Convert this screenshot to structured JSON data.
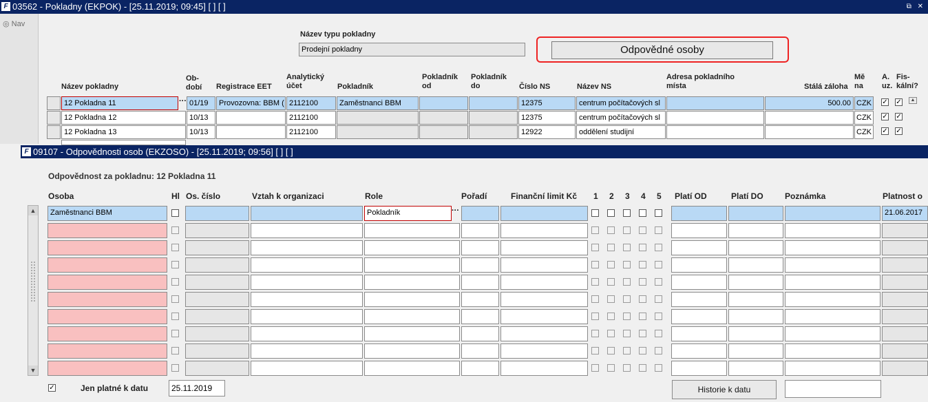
{
  "main_window": {
    "title": "03562 - Pokladny (EKPOK) - [25.11.2019; 09:45]  [ ]  [ ]",
    "window_controls": "⧉ ✕",
    "nav_label": "Nav",
    "typ_label": "Název typu pokladny",
    "typ_value": "Prodejní pokladny",
    "button_label": "Odpovědné osoby",
    "columns": {
      "nazev": "Název pokladny",
      "obdobi": "Ob-\nbodí",
      "registrace": "Registrace EET",
      "ucet": "Analytický\núčet",
      "pokladnik": "Pokladník",
      "pok_od": "Pokladník\nod",
      "pok_do": "Pokladník\ndo",
      "cislo_ns": "Číslo NS",
      "nazev_ns": "Název NS",
      "adresa": "Adresa pokladního\nmísta",
      "zaloha": "Stálá záloha",
      "mena": "Mě\nna",
      "auz": "A.\nuz.",
      "fiskalni": "Fis-\nkální?"
    },
    "rows": [
      {
        "nazev": "12 Pokladna 11",
        "obdobi": "01/19",
        "registrace": "Provozovna: BBM (",
        "ucet": "2112100",
        "pokladnik": "Zaměstnanci BBM",
        "cislo_ns": "12375",
        "nazev_ns": "centrum počítačových sl",
        "zaloha": "500.00",
        "mena": "CZK"
      },
      {
        "nazev": "12 Pokladna 12",
        "obdobi": "10/13",
        "registrace": "",
        "ucet": "2112100",
        "pokladnik": "",
        "cislo_ns": "12375",
        "nazev_ns": "centrum počítačových sl",
        "zaloha": "",
        "mena": "CZK"
      },
      {
        "nazev": "12 Pokladna 13",
        "obdobi": "10/13",
        "registrace": "",
        "ucet": "2112100",
        "pokladnik": "",
        "cislo_ns": "12922",
        "nazev_ns": "oddělení studijní",
        "zaloha": "",
        "mena": "CZK"
      }
    ]
  },
  "sub_window": {
    "title": "09107 - Odpovědnosti osob (EKZOSO) - [25.11.2019; 09:56]  [ ]  [ ]",
    "section_label": "Odpovědnost za pokladnu: 12 Pokladna 11",
    "columns": {
      "osoba": "Osoba",
      "hl": "Hl",
      "os_cislo": "Os. číslo",
      "vztah": "Vztah k organizaci",
      "role": "Role",
      "poradi": "Pořadí",
      "limit": "Finanční limit Kč",
      "c1": "1",
      "c2": "2",
      "c3": "3",
      "c4": "4",
      "c5": "5",
      "plati_od": "Platí OD",
      "plati_do": "Platí DO",
      "poznamka": "Poznámka",
      "platnost": "Platnost o"
    },
    "first_row": {
      "osoba": "Zaměstnanci BBM",
      "role": "Pokladník",
      "platnost": "21.06.2017"
    },
    "footer": {
      "jen_platne_label": "Jen platné k datu",
      "date_value": "25.11.2019",
      "historie_button": "Historie k datu"
    }
  }
}
